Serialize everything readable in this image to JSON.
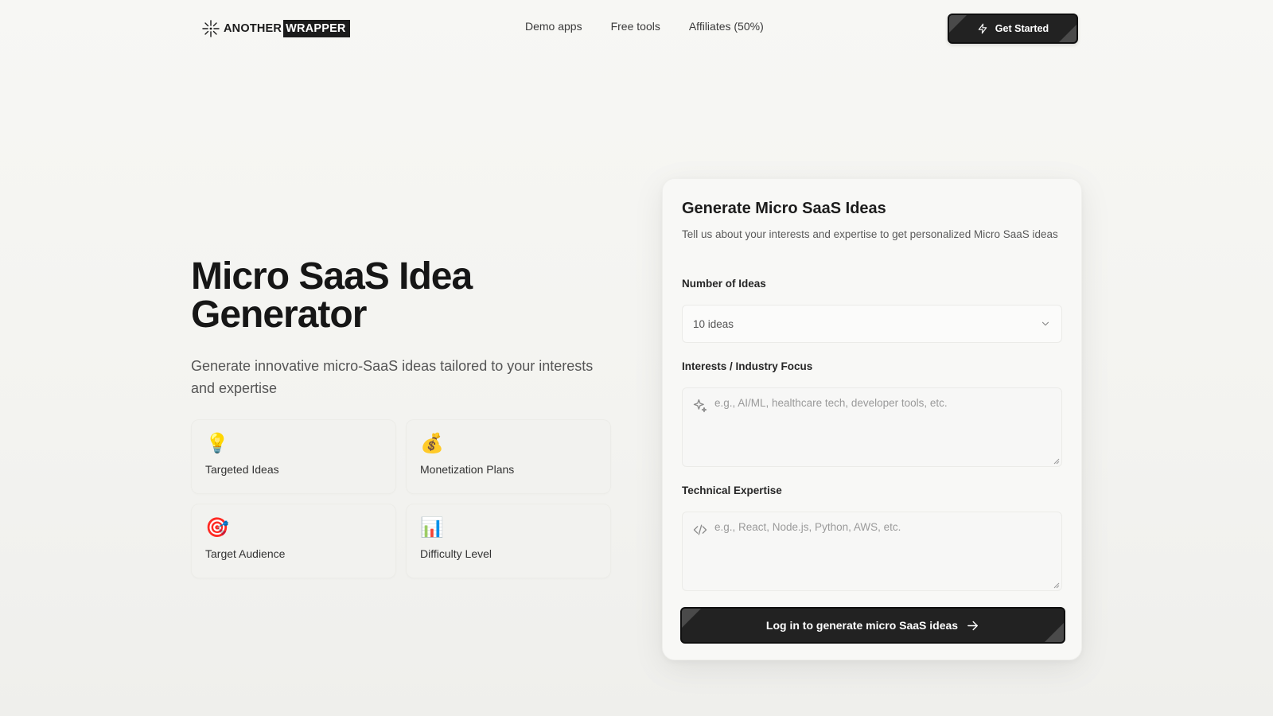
{
  "header": {
    "logo_part1": "ANOTHER",
    "logo_part2": "WRAPPER",
    "nav": [
      {
        "label": "Demo apps"
      },
      {
        "label": "Free tools"
      },
      {
        "label": "Affiliates (50%)"
      }
    ],
    "cta_label": "Get Started",
    "cta_icon": "bolt-icon"
  },
  "hero": {
    "title_line1": "Micro SaaS Idea",
    "title_line2": "Generator",
    "subtitle": "Generate innovative micro-SaaS ideas tailored to your interests and expertise"
  },
  "features": [
    {
      "icon": "💡",
      "icon_name": "lightbulb-icon",
      "label": "Targeted Ideas"
    },
    {
      "icon": "💰",
      "icon_name": "money-bag-icon",
      "label": "Monetization Plans"
    },
    {
      "icon": "🎯",
      "icon_name": "target-icon",
      "label": "Target Audience"
    },
    {
      "icon": "📊",
      "icon_name": "bar-chart-icon",
      "label": "Difficulty Level"
    }
  ],
  "form": {
    "title": "Generate Micro SaaS Ideas",
    "description": "Tell us about your interests and expertise to get personalized Micro SaaS ideas",
    "number_label": "Number of Ideas",
    "number_value": "10 ideas",
    "interests_label": "Interests / Industry Focus",
    "interests_placeholder": "e.g., AI/ML, healthcare tech, developer tools, etc.",
    "expertise_label": "Technical Expertise",
    "expertise_placeholder": "e.g., React, Node.js, Python, AWS, etc.",
    "submit_label": "Log in to generate micro SaaS ideas"
  },
  "colors": {
    "background": "#f5f5f2",
    "primary_button": "#222222",
    "text": "#1a1a1a"
  }
}
